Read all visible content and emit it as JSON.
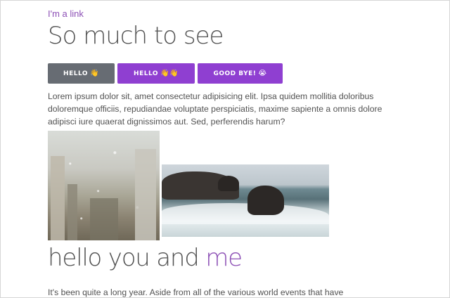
{
  "link": {
    "label": "I'm a link"
  },
  "header": {
    "title": "So much to see"
  },
  "buttons": [
    {
      "label": "HELLO",
      "emoji": "👋",
      "style": "gray"
    },
    {
      "label": "HELLO",
      "emoji": "👋👋",
      "style": "purple"
    },
    {
      "label": "GOOD BYE!",
      "emoji": "😭",
      "style": "purple"
    }
  ],
  "intro": {
    "text": "Lorem ipsum dolor sit, amet consectetur adipisicing elit. Ipsa quidem mollitia doloribus doloremque officiis, repudiandae voluptate perspiciatis, maxime sapiente a omnis dolore adipisci iure quaerat dignissimos aut. Sed, perferendis harum?"
  },
  "images": [
    {
      "name": "rainy-window-image"
    },
    {
      "name": "ocean-rocks-image"
    }
  ],
  "section": {
    "heading_plain": "hello you and ",
    "heading_accent": "me",
    "text": "It's been quite a long year. Aside from all of the various world events that have"
  },
  "colors": {
    "accent": "#8c4fb5",
    "button_purple": "#8f3fd1",
    "button_gray": "#676c73",
    "text": "#525252"
  }
}
